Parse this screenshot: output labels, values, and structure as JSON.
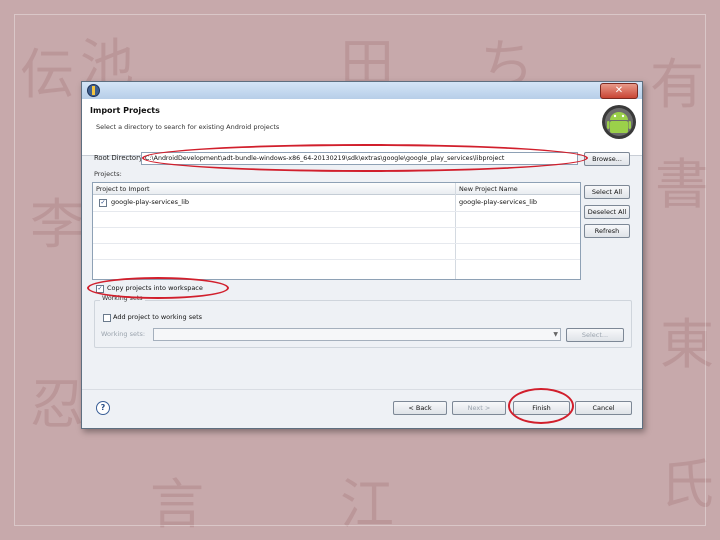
{
  "dialog": {
    "title": "Import Projects",
    "subtitle": "Select a directory to search for existing Android projects",
    "root_label": "Root Directory:",
    "root_value": "C:\\AndroidDevelopment\\adt-bundle-windows-x86_64-20130219\\sdk\\extras\\google\\google_play_services\\libproject",
    "browse_label": "Browse...",
    "projects_label": "Projects:",
    "table": {
      "headers": [
        "Project to Import",
        "New Project Name"
      ],
      "rows": [
        {
          "checked": true,
          "project": "google-play-services_lib",
          "new_name": "google-play-services_lib"
        }
      ]
    },
    "select_all": "Select All",
    "deselect_all": "Deselect All",
    "refresh": "Refresh",
    "copy_label": "Copy projects into workspace",
    "working_sets_legend": "Working sets",
    "add_to_working_sets": "Add project to working sets",
    "working_sets_field_label": "Working sets:",
    "select_button": "Select...",
    "back": "< Back",
    "next": "Next >",
    "finish": "Finish",
    "cancel": "Cancel",
    "help_glyph": "?",
    "close_glyph": "✕"
  },
  "colors": {
    "annotation_red": "#d11f2c",
    "slide_background": "#c7a9ab"
  }
}
